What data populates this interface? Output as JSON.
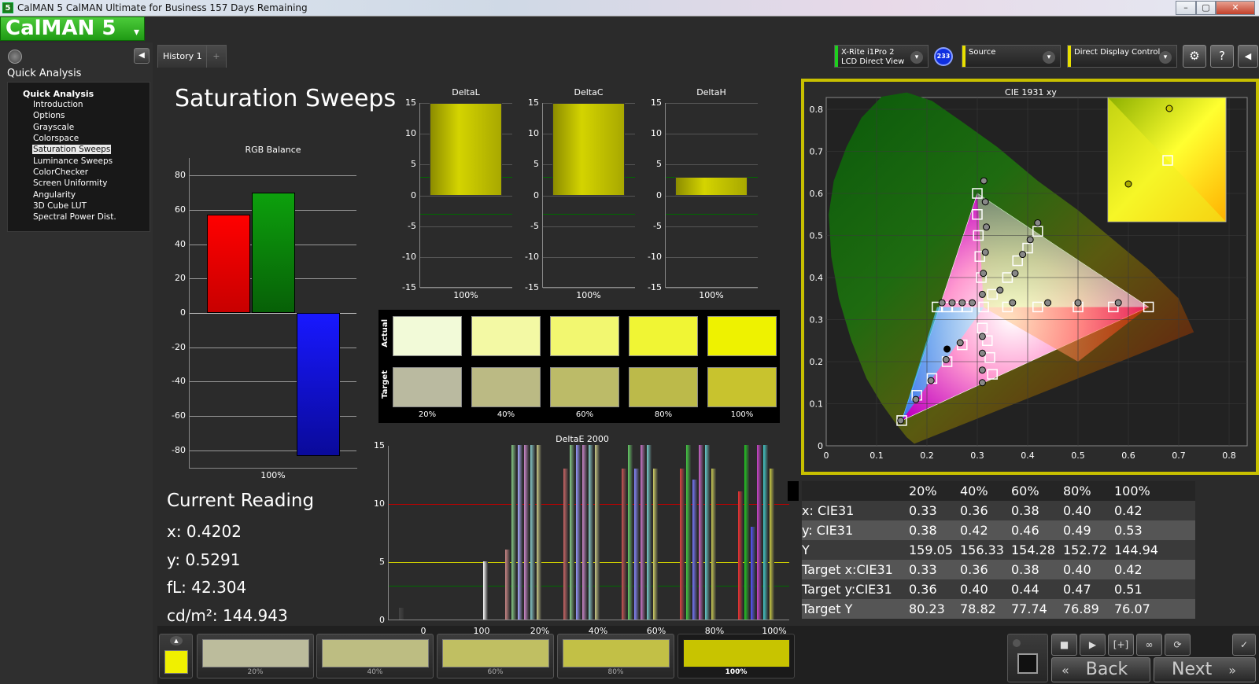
{
  "window": {
    "title": "CalMAN 5 CalMAN Ultimate for Business 157 Days Remaining",
    "app_icon": "5",
    "controls": [
      "–",
      "▢",
      "✕"
    ]
  },
  "logo": {
    "text": "CalMAN 5"
  },
  "sidebar": {
    "title": "Quick Analysis",
    "root": "Quick Analysis",
    "items": [
      "Introduction",
      "Options",
      "Grayscale",
      "Colorspace",
      "Saturation Sweeps",
      "Luminance Sweeps",
      "ColorChecker",
      "Screen Uniformity",
      "Angularity",
      "3D Cube LUT",
      "Spectral Power Dist."
    ],
    "selected": "Saturation Sweeps"
  },
  "tabs": {
    "history": "History 1",
    "add": "+"
  },
  "devices": {
    "meter": {
      "line1": "X-Rite i1Pro 2",
      "line2": "LCD Direct View",
      "badge": "233"
    },
    "source": {
      "label": "Source"
    },
    "display": {
      "label": "Direct Display Control"
    }
  },
  "page": {
    "title": "Saturation Sweeps"
  },
  "rgb_balance": {
    "title": "RGB Balance",
    "xlabel": "100%",
    "yticks": [
      "80",
      "60",
      "40",
      "20",
      "0",
      "-20",
      "-40",
      "-60",
      "-80"
    ],
    "red": 57,
    "green": 70,
    "blue": -83,
    "colors": {
      "red": "#ff0000",
      "green": "#0a8a0a",
      "blue": "#1010ff"
    }
  },
  "current_reading": {
    "title": "Current Reading",
    "x": "x: 0.4202",
    "y": "y: 0.5291",
    "fl": "fL: 42.304",
    "cdm2": "cd/m²: 144.943"
  },
  "delta_charts": {
    "yticks": [
      "15",
      "10",
      "5",
      "0",
      "-5",
      "-10",
      "-15"
    ],
    "xlabel": "100%",
    "items": [
      {
        "title": "DeltaL",
        "value": 15
      },
      {
        "title": "DeltaC",
        "value": 15
      },
      {
        "title": "DeltaH",
        "value": 3
      }
    ]
  },
  "swatches": {
    "actual_label": "Actual",
    "target_label": "Target",
    "labels": [
      "20%",
      "40%",
      "60%",
      "80%",
      "100%"
    ],
    "actual_colors": [
      "#f2fad8",
      "#f3f9a4",
      "#f2f770",
      "#f0f534",
      "#eef200"
    ],
    "target_colors": [
      "#babaa0",
      "#bbba84",
      "#bcbb68",
      "#bcba4a",
      "#c8c32e"
    ]
  },
  "deltae": {
    "title": "DeltaE 2000",
    "yticks": [
      "15",
      "10",
      "5",
      "0"
    ],
    "xticks": [
      "0",
      "100",
      "20%",
      "40%",
      "60%",
      "80%",
      "100%"
    ]
  },
  "cie": {
    "title": "CIE 1931 xy",
    "xticks": [
      "0",
      "0.1",
      "0.2",
      "0.3",
      "0.4",
      "0.5",
      "0.6",
      "0.7",
      "0.8"
    ],
    "yticks": [
      "0.8",
      "0.7",
      "0.6",
      "0.5",
      "0.4",
      "0.3",
      "0.2",
      "0.1",
      "0"
    ]
  },
  "table": {
    "headers": [
      "",
      "20%",
      "40%",
      "60%",
      "80%",
      "100%"
    ],
    "rows": [
      [
        "x: CIE31",
        "0.33",
        "0.36",
        "0.38",
        "0.40",
        "0.42"
      ],
      [
        "y: CIE31",
        "0.38",
        "0.42",
        "0.46",
        "0.49",
        "0.53"
      ],
      [
        "Y",
        "159.05",
        "156.33",
        "154.28",
        "152.72",
        "144.94"
      ],
      [
        "Target x:CIE31",
        "0.33",
        "0.36",
        "0.38",
        "0.40",
        "0.42"
      ],
      [
        "Target y:CIE31",
        "0.36",
        "0.40",
        "0.44",
        "0.47",
        "0.51"
      ],
      [
        "Target Y",
        "80.23",
        "78.82",
        "77.74",
        "76.89",
        "76.07"
      ]
    ]
  },
  "bottom": {
    "current_color": "#f0f000",
    "patches": [
      {
        "label": "20%",
        "color": "#bcbc9c"
      },
      {
        "label": "40%",
        "color": "#bdbd82"
      },
      {
        "label": "60%",
        "color": "#c0bf62"
      },
      {
        "label": "80%",
        "color": "#c2c046"
      },
      {
        "label": "100%",
        "color": "#c8c400"
      }
    ],
    "back": "Back",
    "next": "Next"
  }
}
